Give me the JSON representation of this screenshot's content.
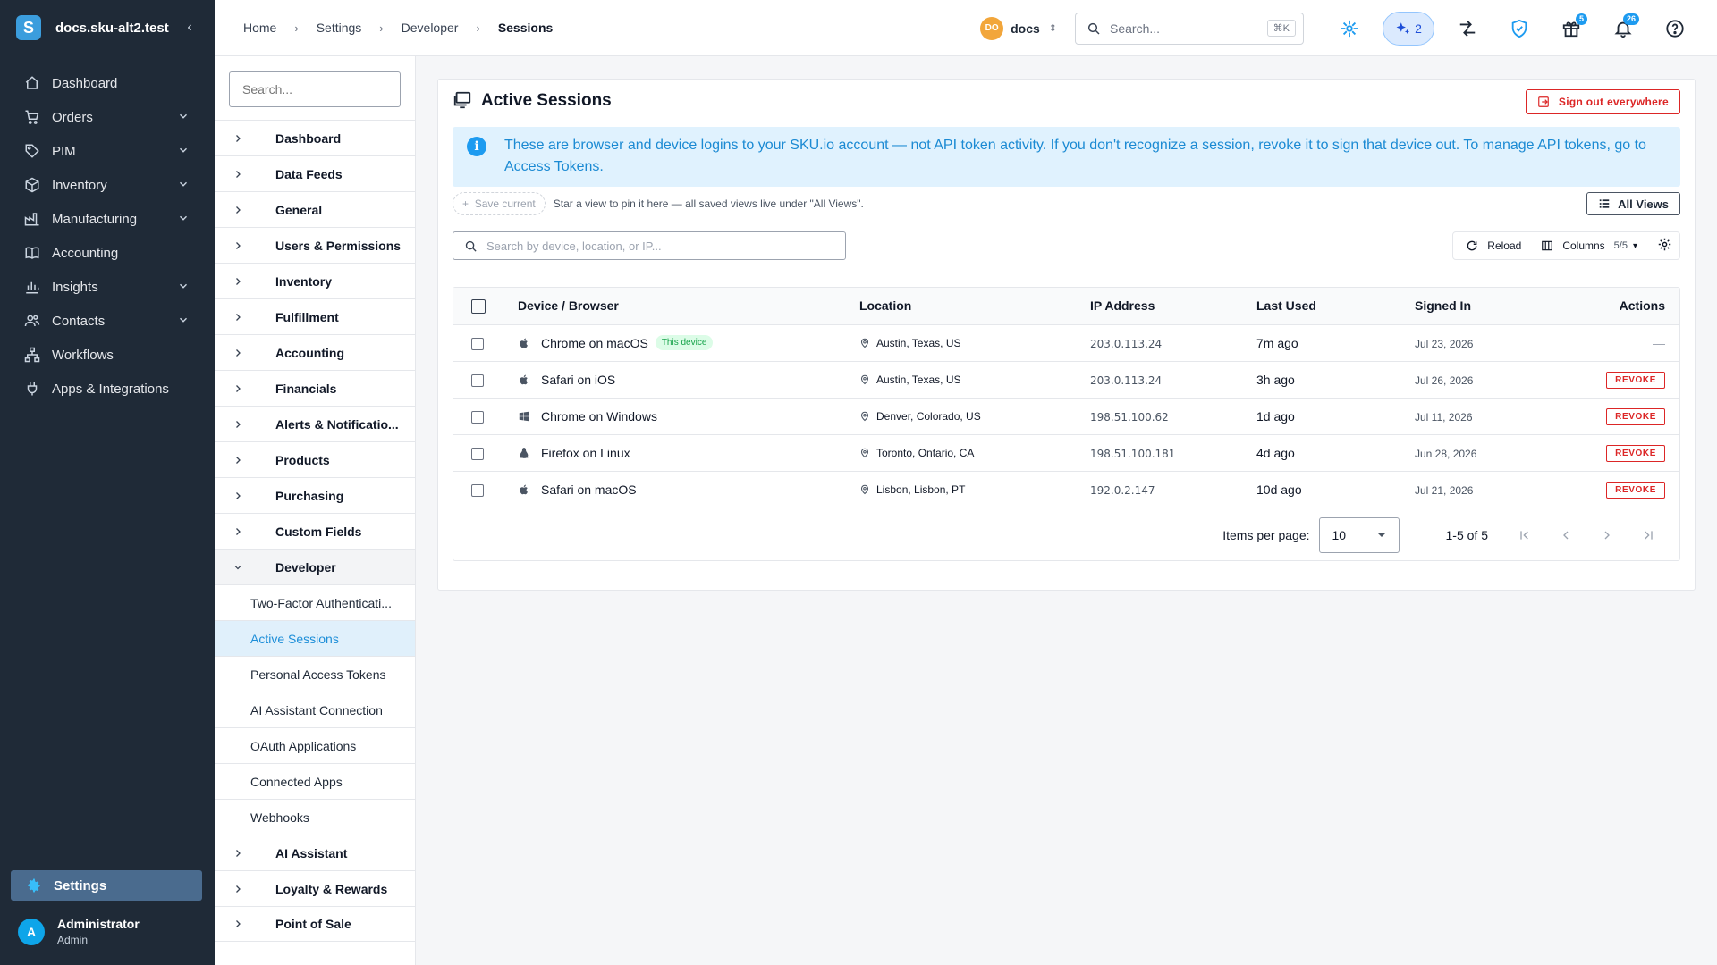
{
  "sidebar": {
    "brand": "docs.sku-alt2.test",
    "items": [
      {
        "label": "Dashboard",
        "icon": "home-icon",
        "expandable": false
      },
      {
        "label": "Orders",
        "icon": "cart-icon",
        "expandable": true
      },
      {
        "label": "PIM",
        "icon": "tag-icon",
        "expandable": true
      },
      {
        "label": "Inventory",
        "icon": "box-icon",
        "expandable": true
      },
      {
        "label": "Manufacturing",
        "icon": "factory-icon",
        "expandable": true
      },
      {
        "label": "Accounting",
        "icon": "book-icon",
        "expandable": false
      },
      {
        "label": "Insights",
        "icon": "chart-icon",
        "expandable": true
      },
      {
        "label": "Contacts",
        "icon": "people-icon",
        "expandable": true
      },
      {
        "label": "Workflows",
        "icon": "workflow-icon",
        "expandable": false
      },
      {
        "label": "Apps & Integrations",
        "icon": "plug-icon",
        "expandable": false
      }
    ],
    "settings_label": "Settings",
    "user": {
      "initial": "A",
      "name": "Administrator",
      "role": "Admin"
    }
  },
  "topbar": {
    "breadcrumbs": [
      "Home",
      "Settings",
      "Developer",
      "Sessions"
    ],
    "org": {
      "initials": "DO",
      "name": "docs"
    },
    "search_placeholder": "Search...",
    "search_shortcut": "⌘K",
    "ai_count": "2",
    "gift_badge": "5",
    "notification_badge": "26"
  },
  "settings_menu": {
    "search_placeholder": "Search...",
    "items": [
      "Dashboard",
      "Data Feeds",
      "General",
      "Users & Permissions",
      "Inventory",
      "Fulfillment",
      "Accounting",
      "Financials",
      "Alerts & Notificatio...",
      "Products",
      "Purchasing",
      "Custom Fields"
    ],
    "open_item": "Developer",
    "developer_sub": [
      "Two-Factor Authenticati...",
      "Active Sessions",
      "Personal Access Tokens",
      "AI Assistant Connection",
      "OAuth Applications",
      "Connected Apps",
      "Webhooks"
    ],
    "active_sub": "Active Sessions",
    "after_items": [
      "AI Assistant",
      "Loyalty & Rewards",
      "Point of Sale"
    ]
  },
  "main": {
    "title": "Active Sessions",
    "sign_out_label": "Sign out everywhere",
    "info_text": "These are browser and device logins to your SKU.io account — not API token activity. If you don't recognize a session, revoke it to sign that device out. To manage API tokens, go to ",
    "info_link": "Access Tokens",
    "info_suffix": ".",
    "save_current": "Save current",
    "views_hint": "Star a view to pin it here — all saved views live under \"All Views\".",
    "all_views": "All Views",
    "table_search_placeholder": "Search by device, location, or IP...",
    "reload_label": "Reload",
    "columns_label": "Columns",
    "columns_count": "5/5",
    "columns": [
      "Device / Browser",
      "Location",
      "IP Address",
      "Last Used",
      "Signed In",
      "Actions"
    ],
    "rows": [
      {
        "device": "Chrome on macOS",
        "os": "apple",
        "this_device": "This device",
        "location": "Austin, Texas, US",
        "ip": "203.0.113.24",
        "last_used": "7m ago",
        "signed_in": "Jul 23, 2026",
        "action": "—"
      },
      {
        "device": "Safari on iOS",
        "os": "apple",
        "this_device": "",
        "location": "Austin, Texas, US",
        "ip": "203.0.113.24",
        "last_used": "3h ago",
        "signed_in": "Jul 26, 2026",
        "action": "REVOKE"
      },
      {
        "device": "Chrome on Windows",
        "os": "windows",
        "this_device": "",
        "location": "Denver, Colorado, US",
        "ip": "198.51.100.62",
        "last_used": "1d ago",
        "signed_in": "Jul 11, 2026",
        "action": "REVOKE"
      },
      {
        "device": "Firefox on Linux",
        "os": "linux",
        "this_device": "",
        "location": "Toronto, Ontario, CA",
        "ip": "198.51.100.181",
        "last_used": "4d ago",
        "signed_in": "Jun 28, 2026",
        "action": "REVOKE"
      },
      {
        "device": "Safari on macOS",
        "os": "apple",
        "this_device": "",
        "location": "Lisbon, Lisbon, PT",
        "ip": "192.0.2.147",
        "last_used": "10d ago",
        "signed_in": "Jul 21, 2026",
        "action": "REVOKE"
      }
    ],
    "pager": {
      "items_per_page_label": "Items per page:",
      "per_page": "10",
      "range": "1-5 of 5"
    }
  }
}
